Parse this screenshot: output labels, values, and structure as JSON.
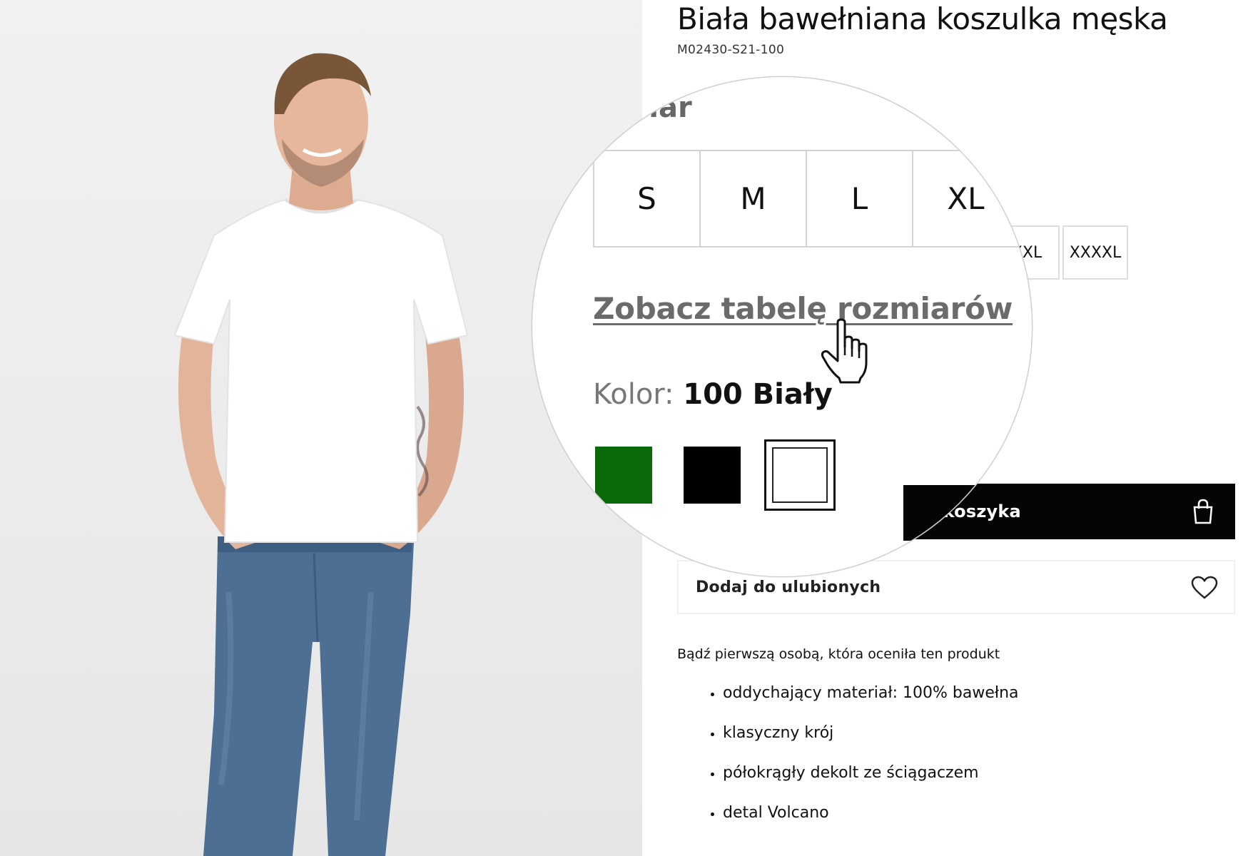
{
  "product": {
    "title": "Biała bawełniana koszulka męska",
    "sku": "M02430-S21-100"
  },
  "sizes": {
    "label": "Rozmiar",
    "visible_large": [
      "S",
      "M",
      "L",
      "XL"
    ],
    "visible_small": [
      "XXL",
      "XXXXL"
    ],
    "size_chart_link": "Zobacz tabelę rozmiarów"
  },
  "color": {
    "label": "Kolor:",
    "value": "100 Biały",
    "swatches": [
      {
        "name": "green",
        "hex": "#0a6a0a"
      },
      {
        "name": "black",
        "hex": "#000000"
      },
      {
        "name": "white",
        "hex": "#ffffff",
        "selected": true
      }
    ]
  },
  "cart": {
    "label_visible_fragment": "do koszyka"
  },
  "favorites": {
    "label": "Dodaj do ulubionych"
  },
  "rating": {
    "text": "Bądź pierwszą osobą, która oceniła ten produkt"
  },
  "features": [
    "oddychający materiał: 100% bawełna",
    "klasyczny krój",
    "półokrągły dekolt ze ściągaczem",
    "detal Volcano"
  ],
  "colors": {
    "cart_button_bg": "#050505",
    "link_gray": "#6b6b6b",
    "border_gray": "#d4d4d4"
  }
}
